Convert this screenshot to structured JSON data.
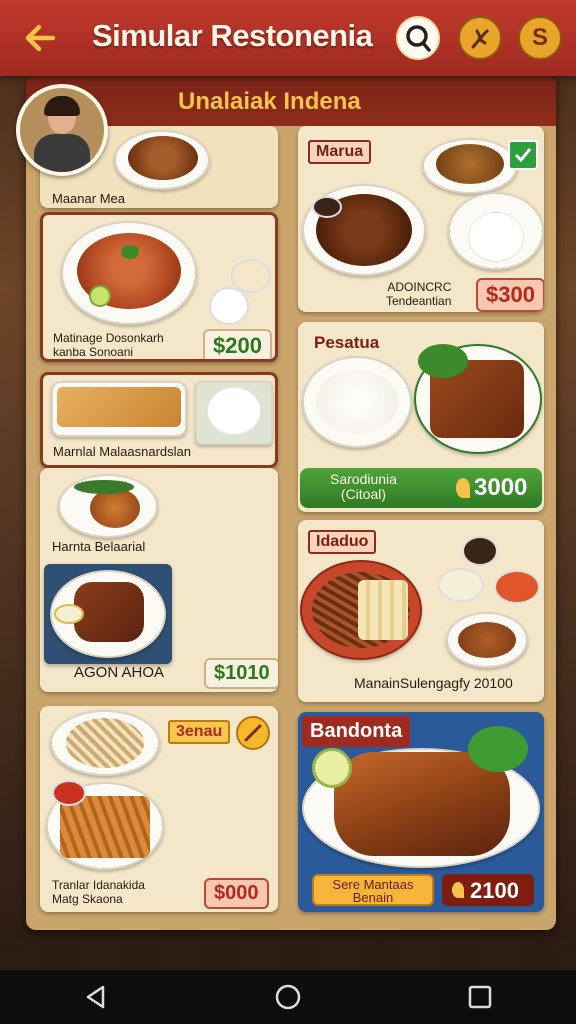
{
  "app": {
    "title": "Simular Restonenia",
    "coin_symbol": "S",
    "colors": {
      "appbar": "#b33125",
      "accent": "#f5c24a",
      "price_green": "#2c7a1f",
      "price_red": "#b22b1d"
    }
  },
  "panel": {
    "title": "Unalaiak Indena"
  },
  "left_column": {
    "top_item": {
      "name": "Maanar Mea"
    },
    "item1": {
      "name": "Matinage Dosonkarh\nkanba Sonoani",
      "price": "$200"
    },
    "item2": {
      "name": "Marnlal Malaasnardslan"
    },
    "item3": {
      "name": "Harnta Belaarial"
    },
    "item4": {
      "name": "AGON AHOA",
      "price": "$1010"
    },
    "item5": {
      "name": "Tranlar Idanakida\nMatg Skaona",
      "tag": "3enau",
      "price": "$000"
    }
  },
  "right_column": {
    "card1": {
      "tag": "Marua",
      "name": "ADOINCRC\nTendeantian",
      "price": "$300"
    },
    "card2": {
      "tag": "Pesatua",
      "button_label": "Sarodiunia\n(Citoal)",
      "price": "3000"
    },
    "card3": {
      "tag": "Idaduo",
      "name": "ManainSulengagfy 20100"
    },
    "card4": {
      "tag": "Bandonta",
      "button_label": "Sere Mantaas\nBenain",
      "price": "2100"
    }
  },
  "icons": {
    "back": "back-arrow-icon",
    "search": "search-icon",
    "fav": "herb-icon",
    "coin": "coin-icon",
    "check": "check-icon"
  },
  "system_nav": {
    "back": "triangle",
    "home": "circle",
    "recents": "square"
  }
}
